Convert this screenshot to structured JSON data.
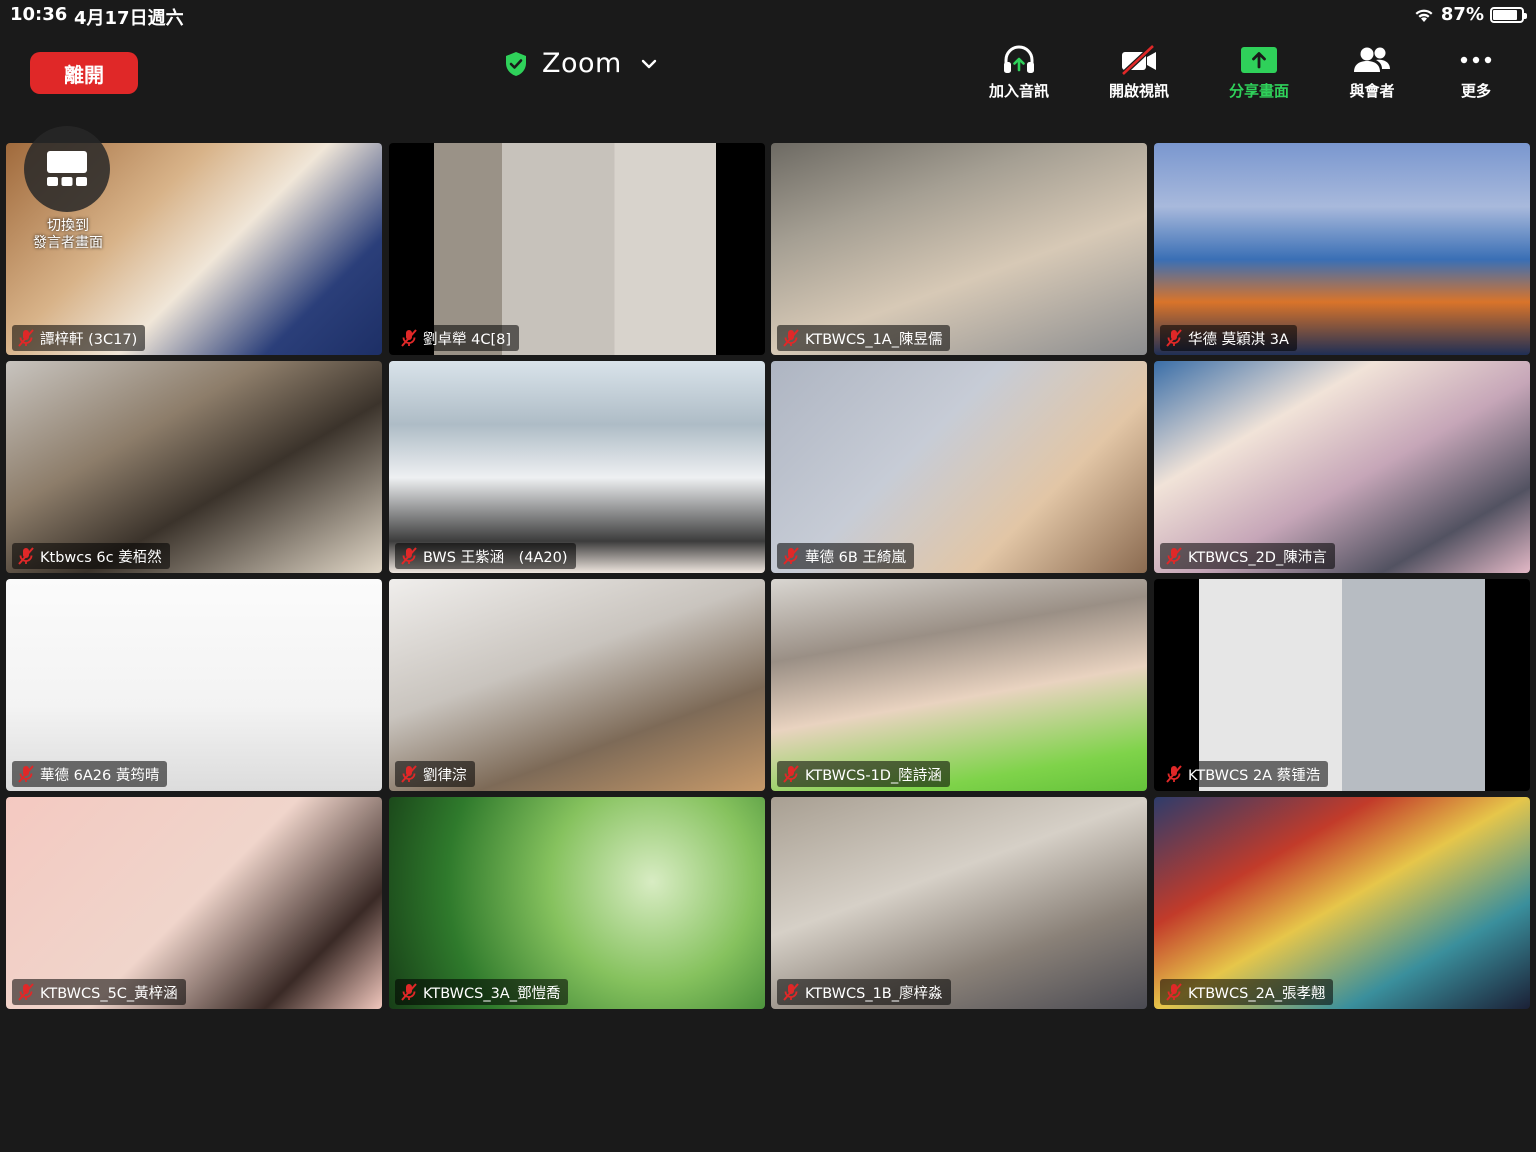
{
  "status": {
    "time": "10:36",
    "date": "4月17日週六",
    "battery": "87%",
    "battery_level": 0.87
  },
  "toolbar": {
    "leave_label": "離開",
    "title": "Zoom",
    "buttons": [
      {
        "label": "加入音訊",
        "icon": "headphones-icon"
      },
      {
        "label": "開啟視訊",
        "icon": "video-off-icon"
      },
      {
        "label": "分享畫面",
        "icon": "share-screen-icon"
      },
      {
        "label": "與會者",
        "icon": "participants-icon"
      },
      {
        "label": "更多",
        "icon": "more-icon"
      }
    ],
    "accent": "#2fd15a",
    "leave_color": "#e02828"
  },
  "switch_view": {
    "label_line1": "切換到",
    "label_line2": "發言者畫面"
  },
  "participants": [
    {
      "name": "譚梓軒 (3C17)"
    },
    {
      "name": "劉卓犖 4C[8]"
    },
    {
      "name": "KTBWCS_1A_陳昱儒"
    },
    {
      "name": "华德 莫穎淇 3A"
    },
    {
      "name": "Ktbwcs 6c 姜栢然"
    },
    {
      "name": "BWS 王紫涵　(4A20)"
    },
    {
      "name": "華德 6B 王綺嵐"
    },
    {
      "name": "KTBWCS_2D_陳沛言"
    },
    {
      "name": "華德 6A26 黃筠晴"
    },
    {
      "name": "劉律淙"
    },
    {
      "name": "KTBWCS-1D_陸詩涵"
    },
    {
      "name": "KTBWCS 2A 蔡锺浩"
    },
    {
      "name": "KTBWCS_5C_黃梓涵"
    },
    {
      "name": "KTBWCS_3A_鄧愷喬"
    },
    {
      "name": "KTBWCS_1B_廖梓淼"
    },
    {
      "name": "KTBWCS_2A_張孝翹"
    }
  ]
}
